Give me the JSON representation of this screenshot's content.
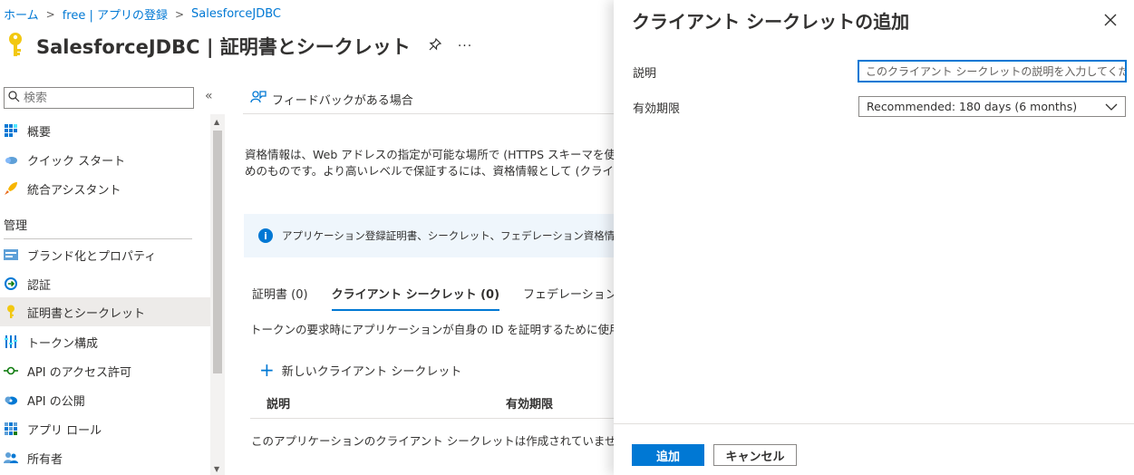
{
  "breadcrumb": [
    "ホーム",
    "free | アプリの登録",
    "SalesforceJDBC"
  ],
  "page": {
    "title": "SalesforceJDBC | 証明書とシークレット",
    "more": "···"
  },
  "sidebar": {
    "search_placeholder": "検索",
    "collapse": "«",
    "section_manage": "管理",
    "items": [
      {
        "label": "概要",
        "icon": "overview-icon"
      },
      {
        "label": "クイック スタート",
        "icon": "quickstart-cloud-icon"
      },
      {
        "label": "統合アシスタント",
        "icon": "rocket-icon"
      },
      {
        "label": "ブランド化とプロパティ",
        "icon": "branding-icon"
      },
      {
        "label": "認証",
        "icon": "authentication-icon"
      },
      {
        "label": "証明書とシークレット",
        "icon": "key-icon"
      },
      {
        "label": "トークン構成",
        "icon": "token-config-icon"
      },
      {
        "label": "API のアクセス許可",
        "icon": "api-permissions-icon"
      },
      {
        "label": "API の公開",
        "icon": "expose-api-icon"
      },
      {
        "label": "アプリ ロール",
        "icon": "app-roles-icon"
      },
      {
        "label": "所有者",
        "icon": "owners-icon"
      }
    ]
  },
  "main": {
    "feedback": "フィードバックがある場合",
    "desc_line1": "資格情報は、Web アドレスの指定が可能な場所で (HTTPS スキーマを使用して)",
    "desc_line2": "めのものです。より高いレベルで保証するには、資格情報として (クライアント シーク",
    "info_banner": "アプリケーション登録証明書、シークレット、フェデレーション資格情報は、下のタブ",
    "tabs": [
      "証明書 (0)",
      "クライアント シークレット (0)",
      "フェデレーション資格情報 ("
    ],
    "tab_desc": "トークンの要求時にアプリケーションが自身の ID を証明するために使用する秘密の",
    "new_secret": "新しいクライアント シークレット",
    "columns": [
      "説明",
      "有効期限"
    ],
    "empty_message": "このアプリケーションのクライアント シークレットは作成されていません。"
  },
  "panel": {
    "title": "クライアント シークレットの追加",
    "description_label": "説明",
    "description_placeholder": "このクライアント シークレットの説明を入力してください",
    "expiry_label": "有効期限",
    "expiry_value": "Recommended: 180 days (6 months)",
    "add_button": "追加",
    "cancel_button": "キャンセル"
  },
  "colors": {
    "accent": "#0078d4",
    "key_icon": "#f2c811"
  }
}
